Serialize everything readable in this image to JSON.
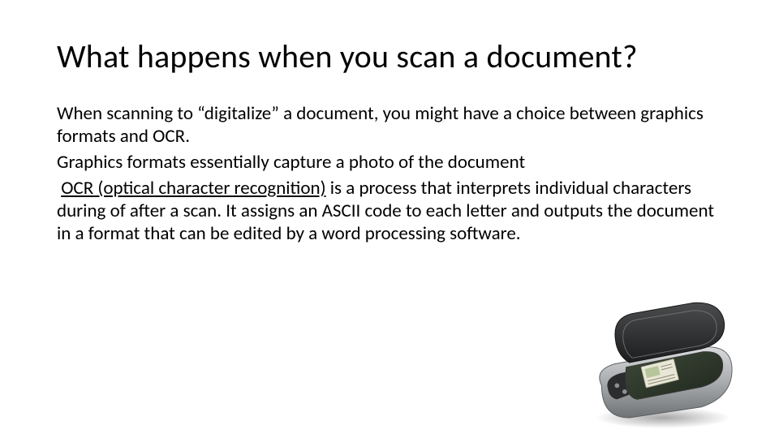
{
  "title": "What happens when you scan a document?",
  "p1": "When scanning to “digitalize” a document, you might have a choice between graphics formats and OCR.",
  "p2": "Graphics formats essentially capture a photo of the document",
  "ocr_leading_space": " ",
  "ocr_term": "OCR (optical character recognition)",
  "ocr_rest": " is a process that interprets individual characters during of after a scan. It assigns an ASCII code to each letter and outputs the document in a format that can be edited by a word processing software.",
  "image_alt": "flatbed-scanner-illustration"
}
